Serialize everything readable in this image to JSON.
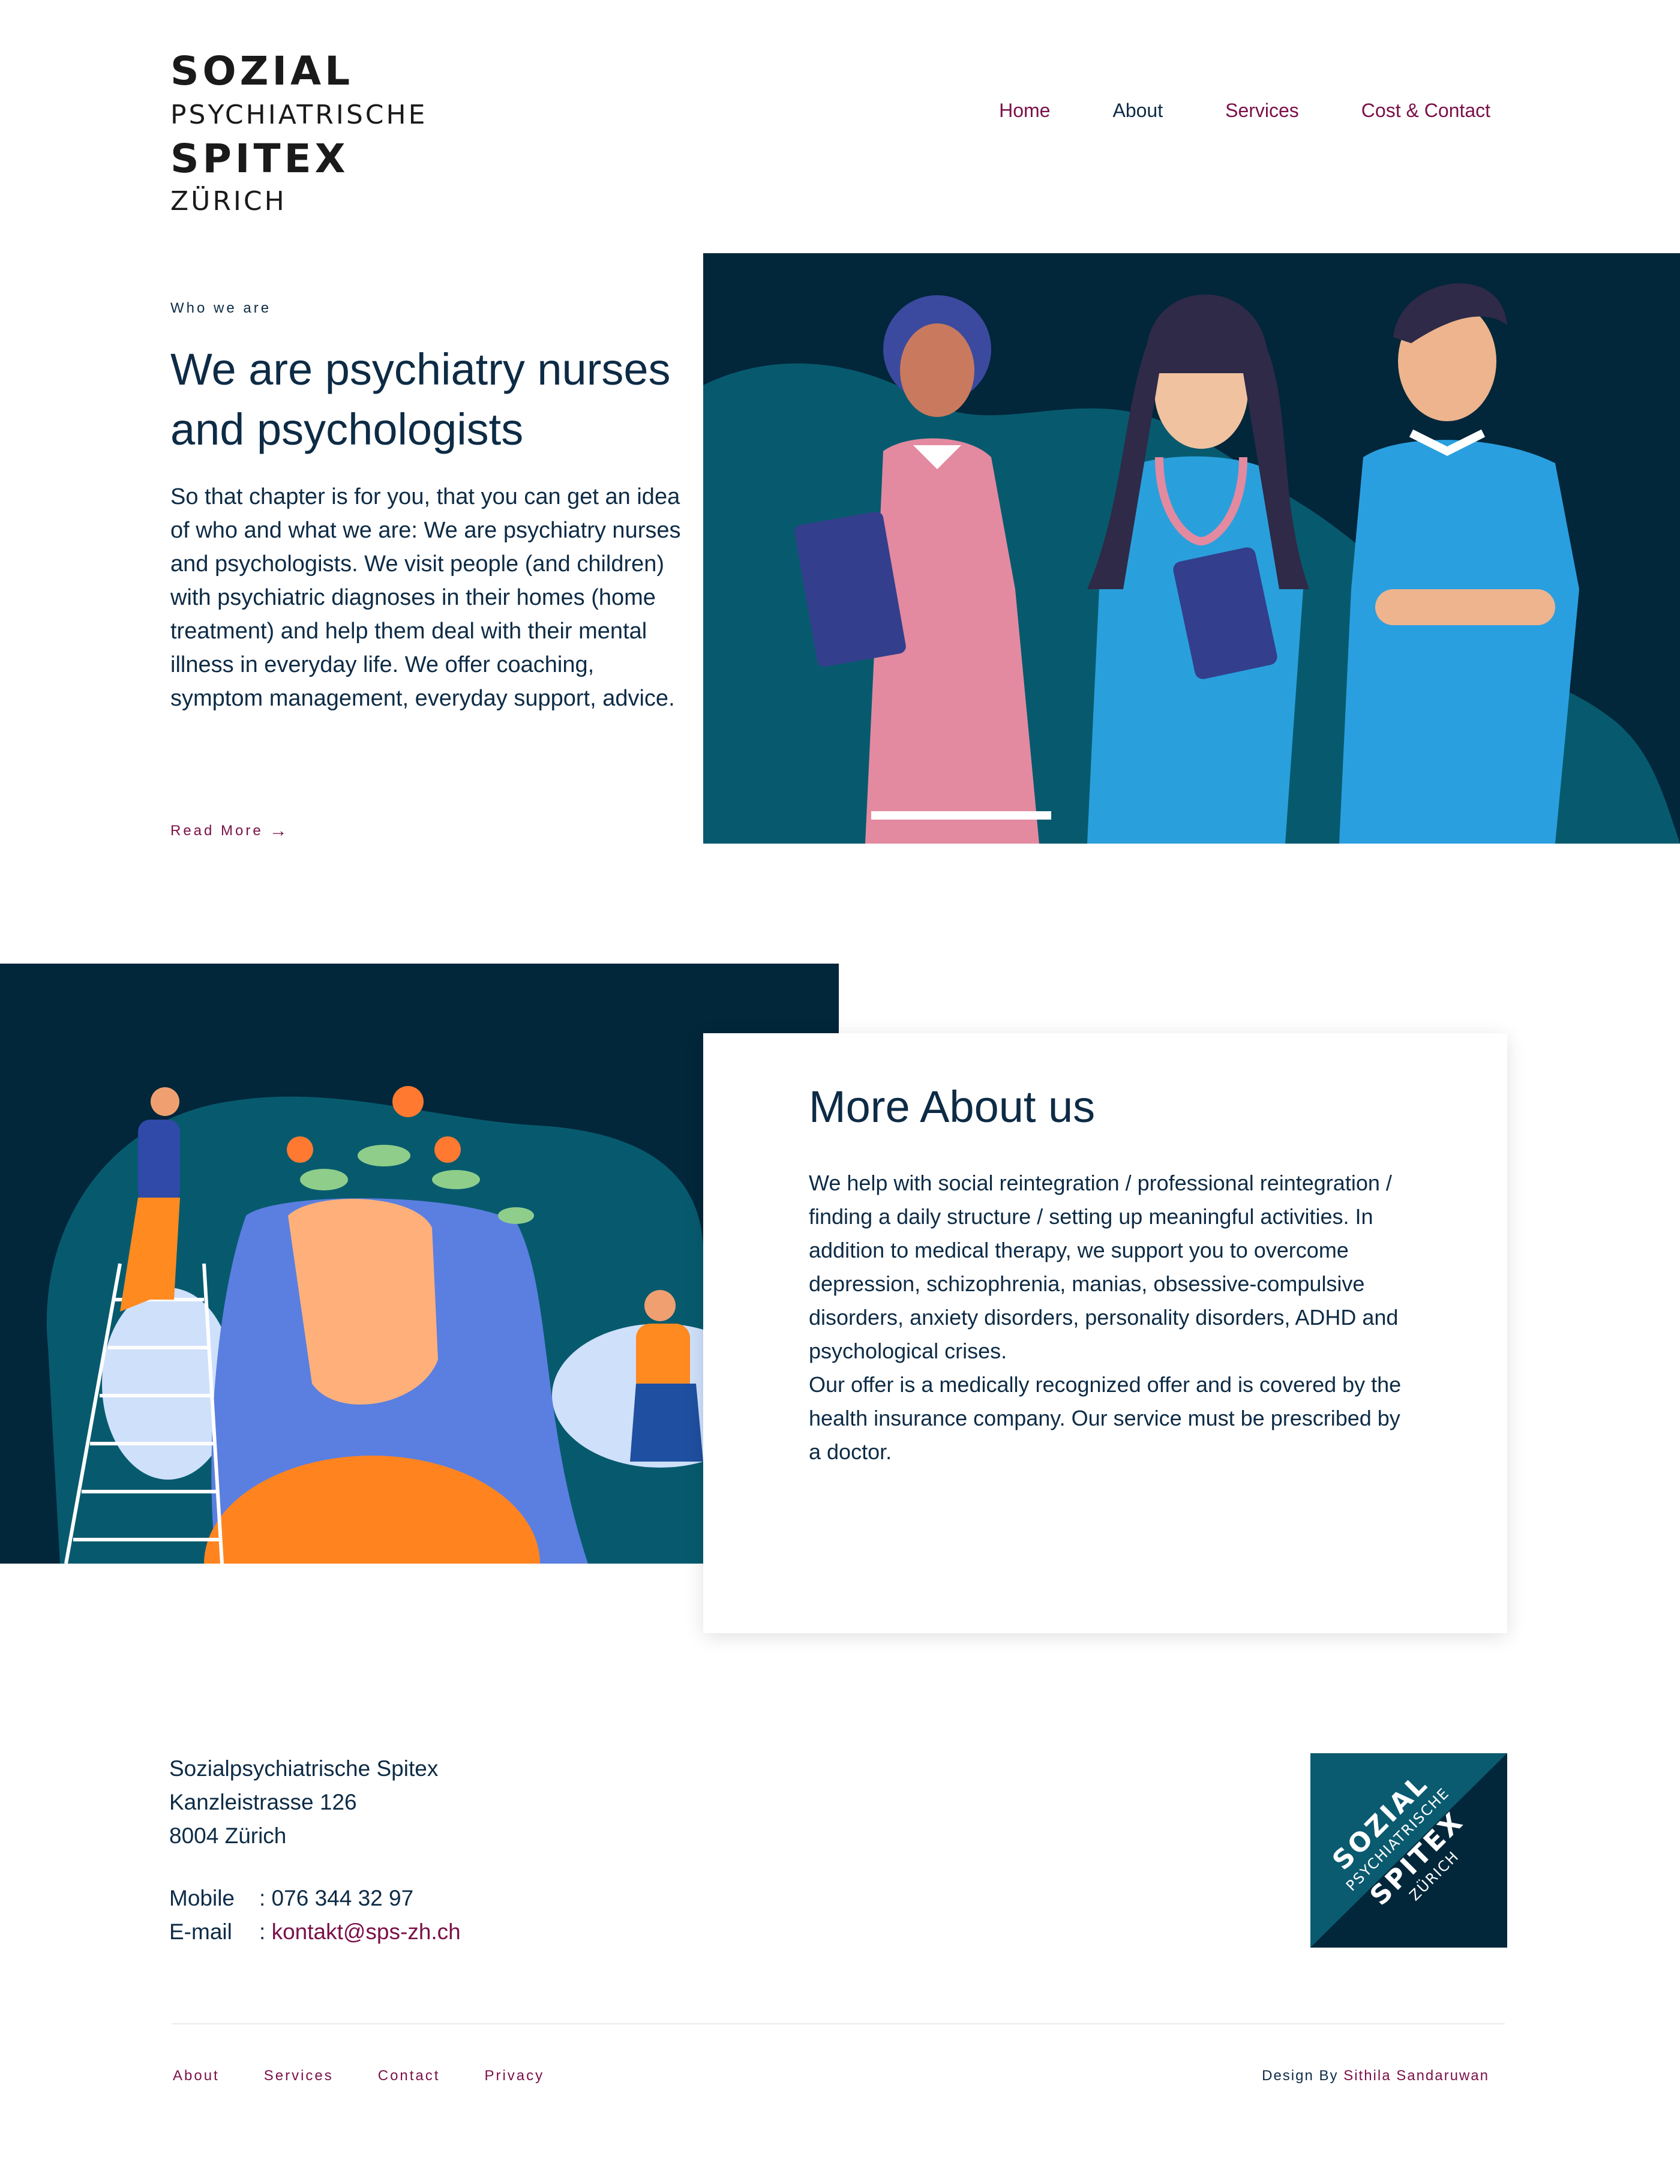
{
  "logo": {
    "line1": "SOZIAL",
    "line2": "PSYCHIATRISCHE",
    "line3": "SPITEX",
    "line4": "ZÜRICH"
  },
  "nav": {
    "home": "Home",
    "about": "About",
    "services": "Services",
    "cost_contact": "Cost & Contact"
  },
  "hero": {
    "eyebrow": "Who we are",
    "title": "We are psychiatry nurses and psychologists",
    "text": "So that chapter is for you, that you can get an idea of who and what we are: We are psychiatry nurses and psychologists. We visit people (and children) with psychiatric diagnoses in their homes (home treatment) and help them deal with their mental illness in everyday life. We offer coaching, symptom management, everyday support, advice.",
    "read_more": "Read More",
    "arrow": "→"
  },
  "about": {
    "title": "More About us",
    "text1": "We help with social reintegration / professional reintegration / finding a daily structure / setting up meaningful activities. In addition to medical therapy, we support you to overcome depression, schizophrenia, manias, obsessive-compulsive disorders, anxiety disorders, personality disorders, ADHD and psychological crises.",
    "text2": "Our offer is a medically recognized offer and is covered by the health insurance company. Our service must be prescribed by a doctor."
  },
  "footer": {
    "address": [
      "Sozialpsychiatrische Spitex",
      "Kanzleistrasse 126",
      "8004 Zürich"
    ],
    "mobile_label": "Mobile",
    "mobile_value": ": 076 344 32 97",
    "email_label": "E-mail",
    "email_sep": ": ",
    "email_value": "kontakt@sps-zh.ch",
    "links": {
      "about": "About",
      "services": "Services",
      "contact": "Contact",
      "privacy": "Privacy"
    },
    "credit_prefix": "Design By ",
    "credit_name": "Sithila Sandaruwan"
  },
  "colors": {
    "navy": "#0d2b45",
    "accent": "#7a1048",
    "dark_bg": "#02263a",
    "teal": "#0a5a70"
  }
}
